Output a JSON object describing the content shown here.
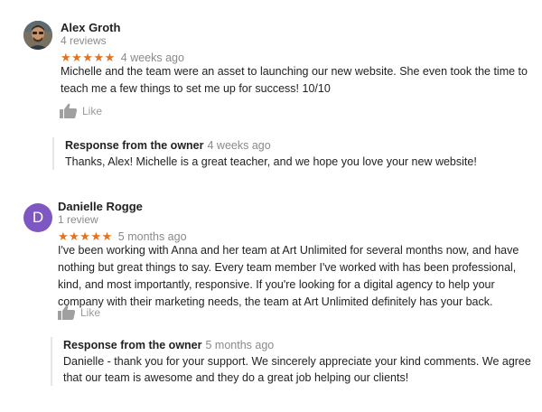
{
  "reviews": [
    {
      "author": "Alex Groth",
      "review_count": "4 reviews",
      "stars": "★★★★★",
      "time": "4 weeks ago",
      "text": "Michelle and the team were an asset to launching our new website. She even took the time to teach me a few things to set me up for success! 10/10",
      "like_label": "Like",
      "owner_response": {
        "title": "Response from the owner",
        "time": "4 weeks ago",
        "text": "Thanks, Alex! Michelle is a great teacher, and we hope you love your new website!"
      }
    },
    {
      "author": "Danielle Rogge",
      "avatar_letter": "D",
      "review_count": "1 review",
      "stars": "★★★★★",
      "time": "5 months ago",
      "text": "I've been working with Anna and her team at Art Unlimited for several months now, and have nothing but great things to say. Every team member I've worked with has been professional, kind, and most importantly, responsive. If you're looking for a digital agency to help your company with their marketing needs, the team at Art Unlimited definitely has your back.",
      "like_label": "Like",
      "owner_response": {
        "title": "Response from the owner",
        "time": "5 months ago",
        "text": "Danielle - thank you for your support. We sincerely appreciate your kind comments. We agree that our team is awesome and they do a great job helping our clients!"
      }
    }
  ],
  "colors": {
    "star": "#e7711b",
    "avatar_letter_bg": "#7e57c2",
    "muted_text": "#8a8a8a"
  },
  "icons": {
    "like": "thumbs-up-icon",
    "avatar_photo": "user-photo-avatar"
  }
}
